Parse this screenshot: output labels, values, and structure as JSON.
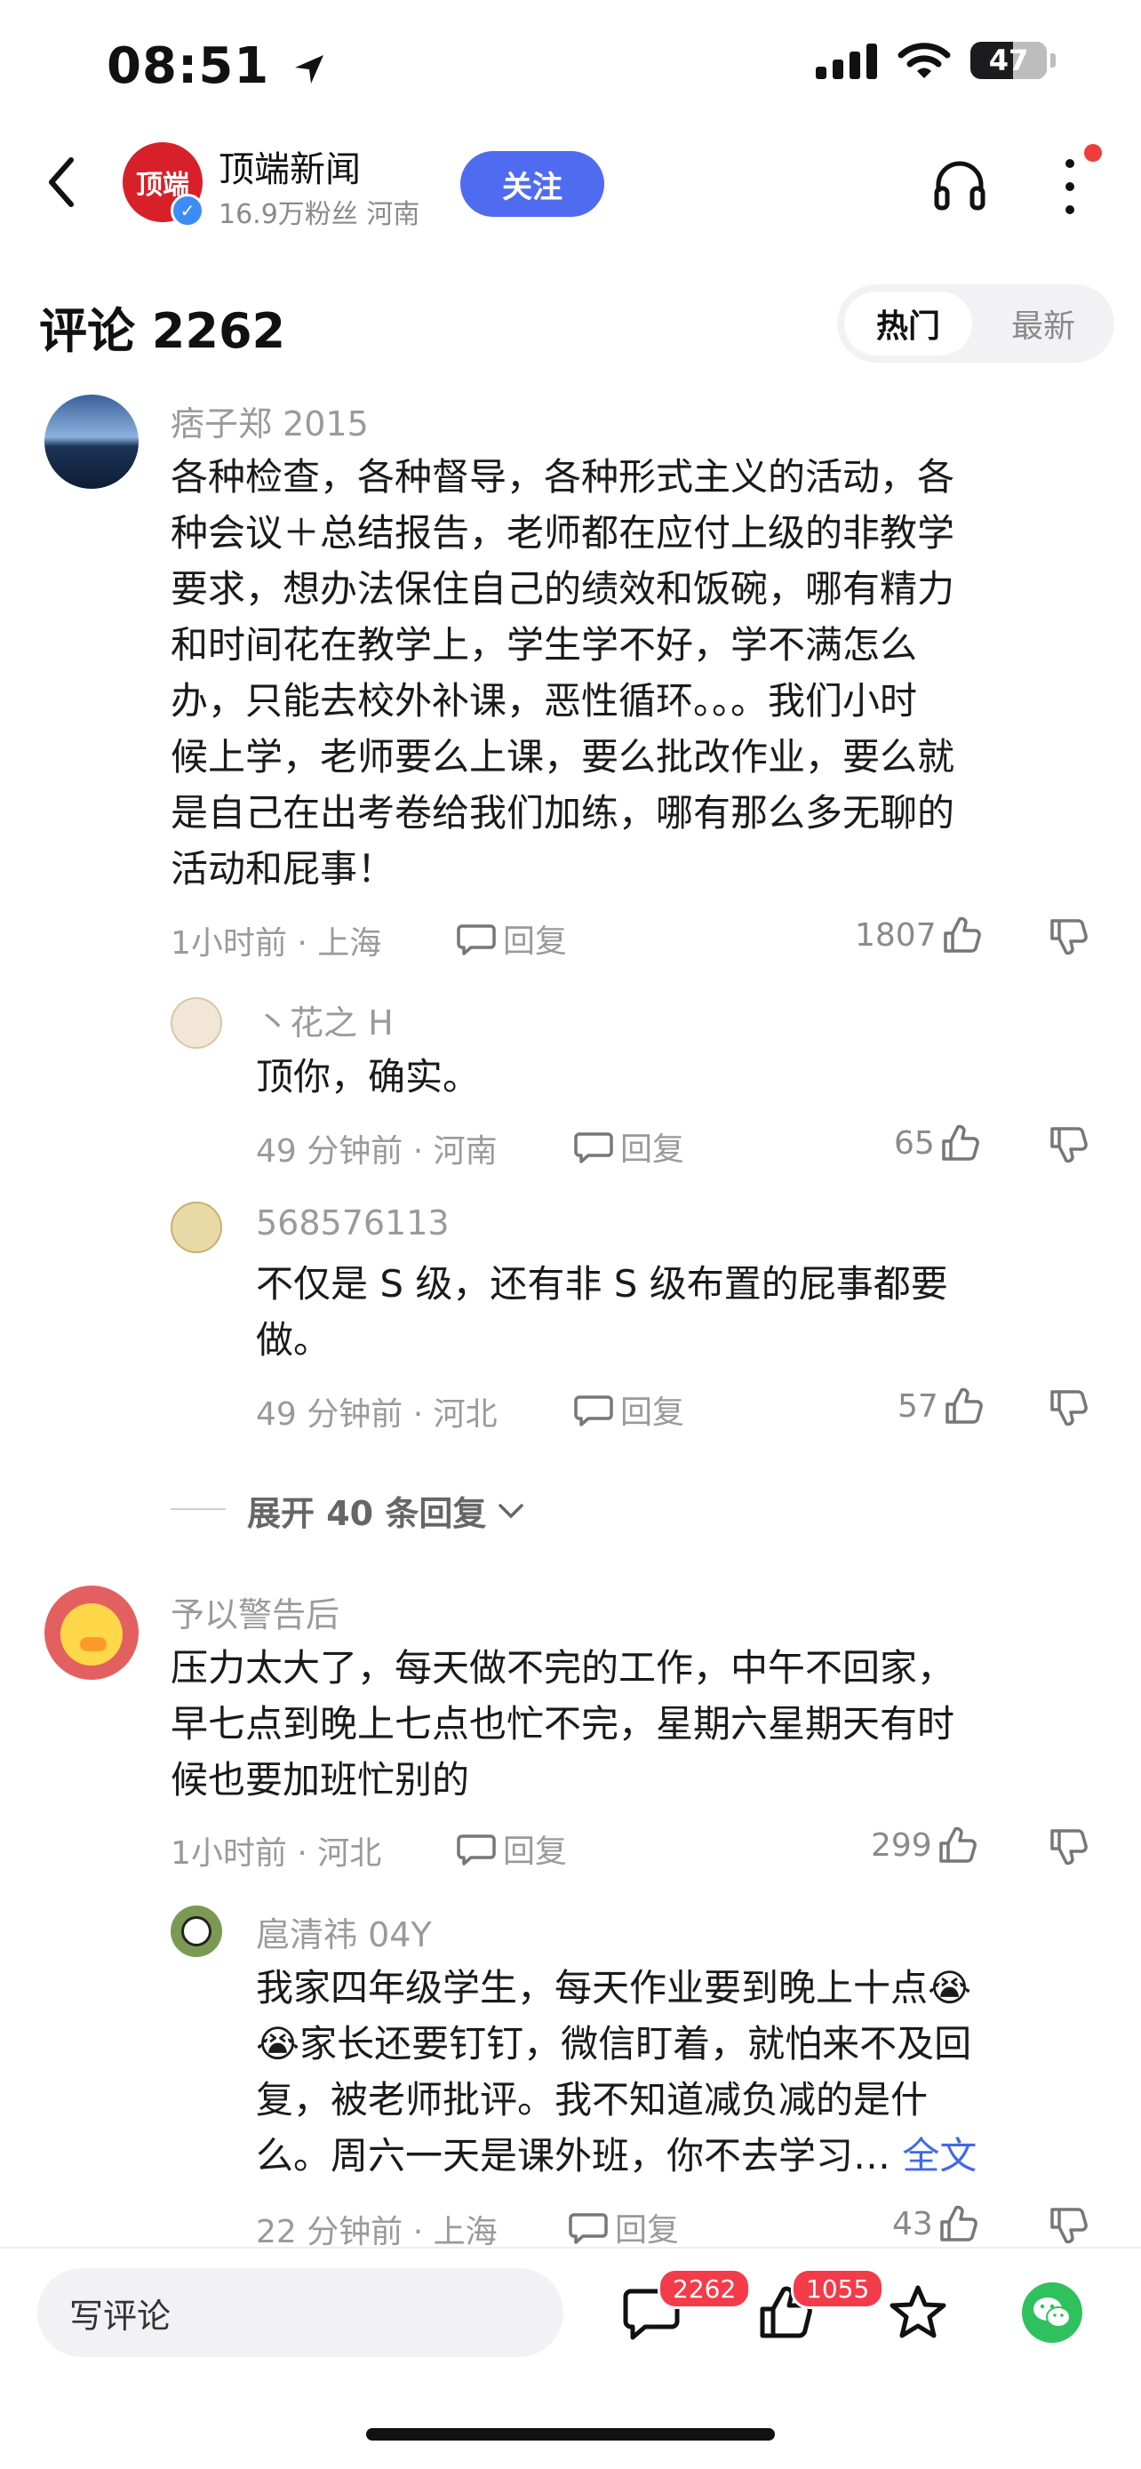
{
  "status_bar": {
    "time": "08:51",
    "battery": "47"
  },
  "header": {
    "logo_text": "顶端",
    "account_name": "顶端新闻",
    "account_sub": "16.9万粉丝 河南",
    "follow_label": "关注"
  },
  "comments_header": {
    "title": "评论 2262",
    "tab_hot": "热门",
    "tab_new": "最新"
  },
  "comments": [
    {
      "user": "痞子郑 2015",
      "text_lines": [
        "各种检查，各种督导，各种形式主义的活动，各",
        "种会议＋总结报告，老师都在应付上级的非教学",
        "要求，想办法保住自己的绩效和饭碗，哪有精力",
        "和时间花在教学上，学生学不好，学不满怎么",
        "办，只能去校外补课，恶性循环。。。我们小时",
        "候上学，老师要么上课，要么批改作业，要么就",
        "是自己在出考卷给我们加练，哪有那么多无聊的",
        "活动和屁事！"
      ],
      "time": "1小时前 · 上海",
      "reply": "回复",
      "likes": "1807",
      "replies": [
        {
          "user": "丶花之 H",
          "text_lines": [
            "顶你，确实。"
          ],
          "time": "49 分钟前 · 河南",
          "reply": "回复",
          "likes": "65"
        },
        {
          "user": "568576113",
          "text_lines": [
            "不仅是 S 级，还有非 S 级布置的屁事都要",
            "做。"
          ],
          "time": "49 分钟前 · 河北",
          "reply": "回复",
          "likes": "57"
        }
      ],
      "expand": "展开 40 条回复"
    },
    {
      "user": "予以警告后",
      "text_lines": [
        "压力太大了，每天做不完的工作，中午不回家，",
        "早七点到晚上七点也忙不完，星期六星期天有时",
        "候也要加班忙别的"
      ],
      "time": "1小时前 · 河北",
      "reply": "回复",
      "likes": "299",
      "replies": [
        {
          "user": "扈清祎 04Y",
          "text_lines": [
            "我家四年级学生，每天作业要到晚上十点😭",
            "😭家长还要钉钉，微信盯着，就怕来不及回",
            "复，被老师批评。我不知道减负减的是什",
            "么。周六一天是课外班，你不去学习…"
          ],
          "full_text": "全文",
          "time": "22 分钟前 · 上海",
          "reply": "回复",
          "likes": "43"
        }
      ]
    }
  ],
  "bottom_bar": {
    "input_placeholder": "写评论",
    "comment_count": "2262",
    "like_count": "1055"
  },
  "colors": {
    "accent": "#4f6cf0",
    "badge": "#f33b4a",
    "wechat": "#2fc15e",
    "link": "#3f6ae8"
  }
}
